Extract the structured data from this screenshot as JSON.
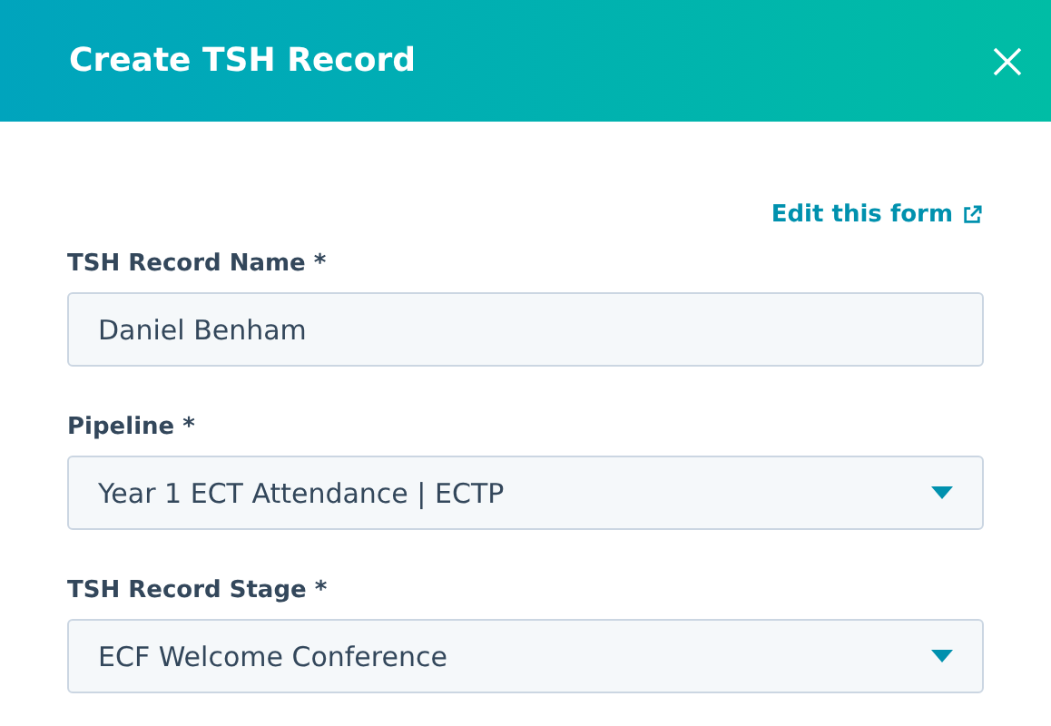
{
  "dialog": {
    "title": "Create TSH Record"
  },
  "edit_link": {
    "label": "Edit this form"
  },
  "fields": [
    {
      "kind": "text",
      "label": "TSH Record Name *",
      "value": "Daniel Benham"
    },
    {
      "kind": "dropdown",
      "label": "Pipeline *",
      "value": "Year 1 ECT Attendance | ECTP"
    },
    {
      "kind": "dropdown",
      "label": "TSH Record Stage *",
      "value": "ECF Welcome Conference"
    }
  ]
}
